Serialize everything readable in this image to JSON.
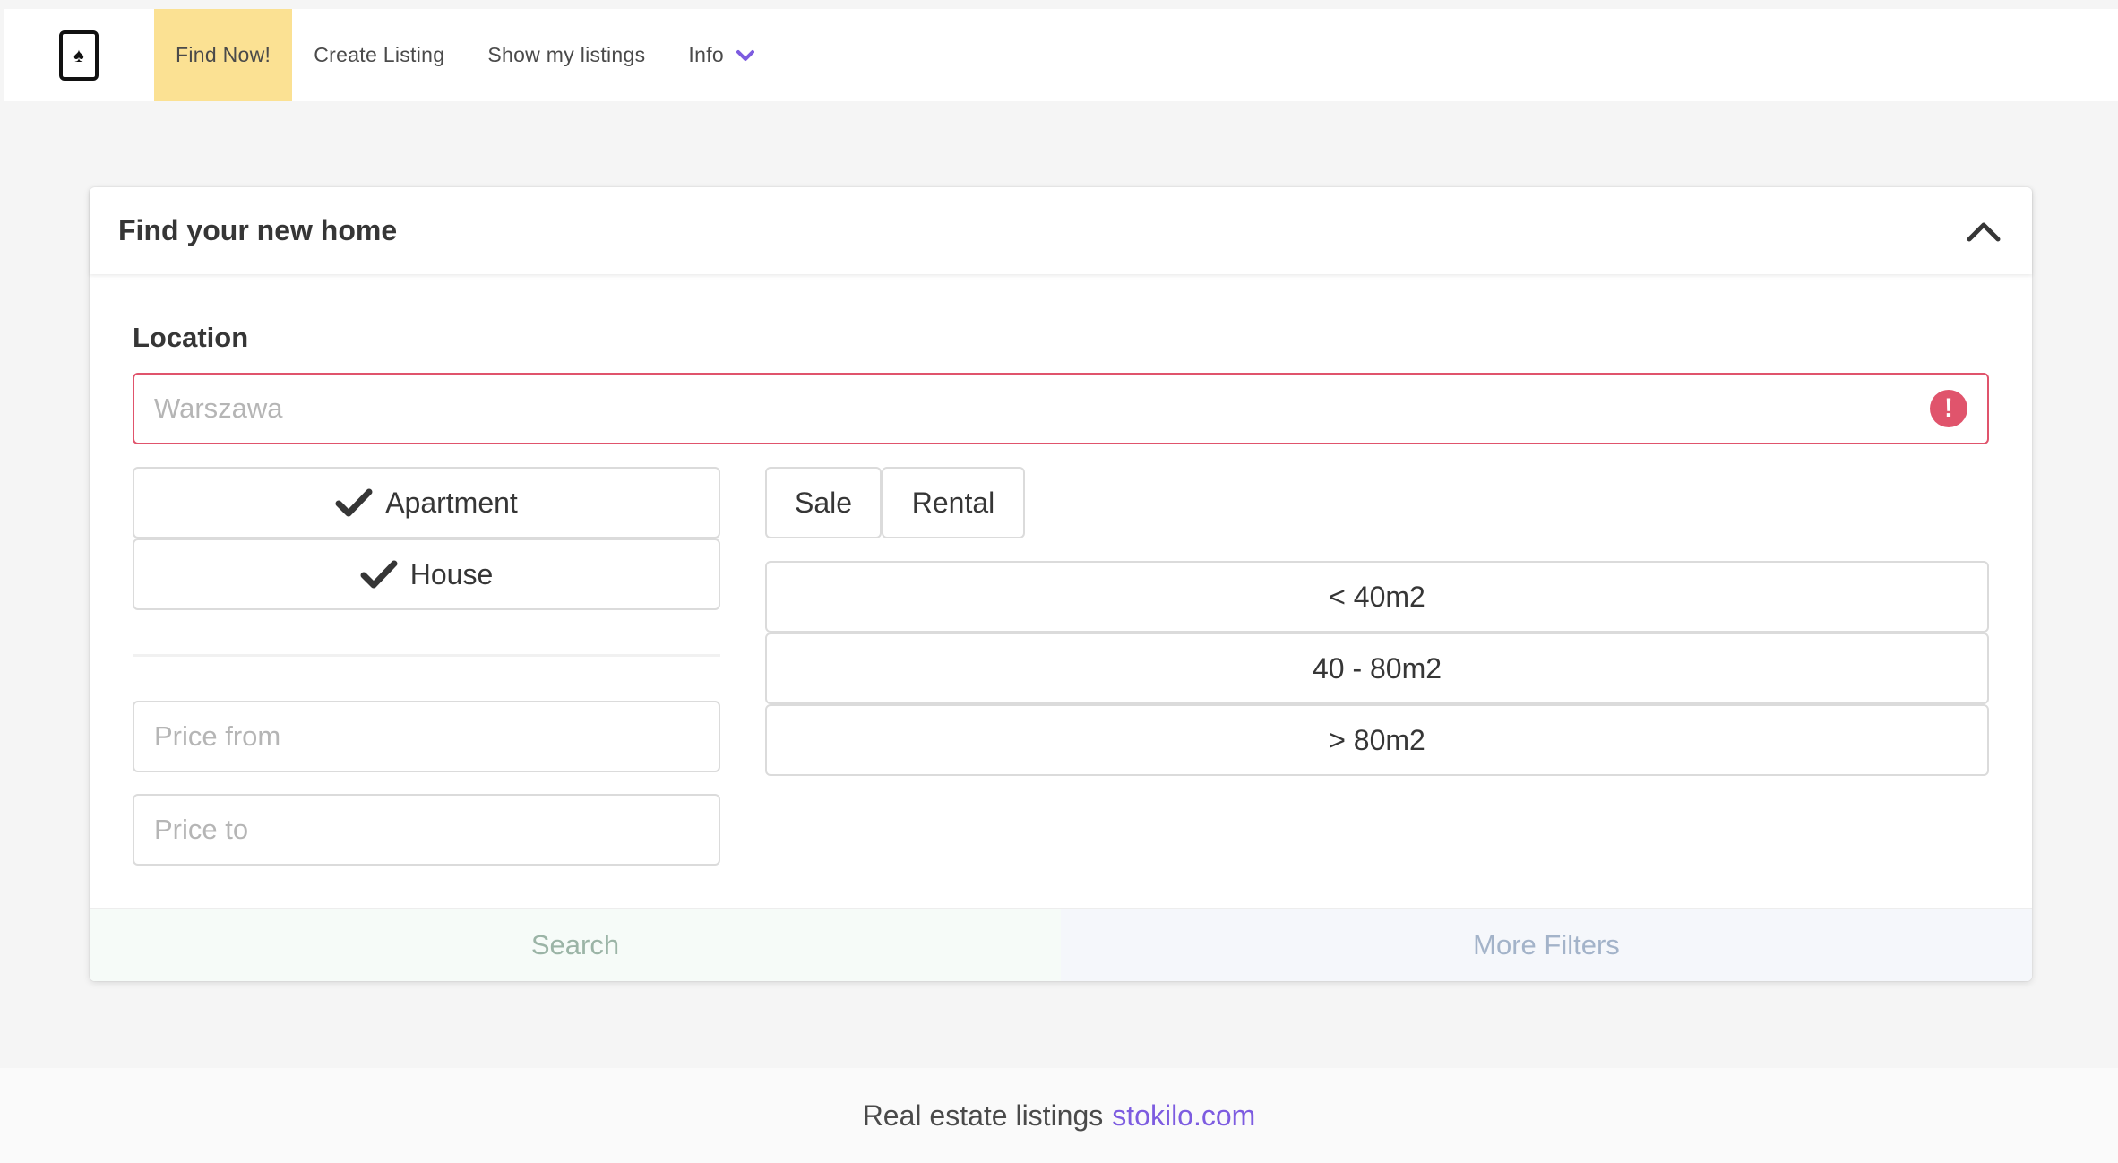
{
  "navbar": {
    "logo_icon": "spade-card-icon",
    "items": [
      {
        "label": "Find Now!",
        "active": true
      },
      {
        "label": "Create Listing",
        "active": false
      },
      {
        "label": "Show my listings",
        "active": false
      },
      {
        "label": "Info",
        "active": false,
        "dropdown": true
      }
    ],
    "active_color": "#fbe193",
    "dropdown_icon_color": "#7d5ce0"
  },
  "card": {
    "title": "Find your new home",
    "collapse_icon": "chevron-up-icon",
    "location": {
      "label": "Location",
      "placeholder": "Warszawa",
      "value": "",
      "error_icon": "exclamation-circle-icon",
      "error_color": "#e0546c"
    },
    "property_types": [
      {
        "label": "Apartment",
        "checked": true
      },
      {
        "label": "House",
        "checked": true
      }
    ],
    "offer_types": [
      {
        "label": "Sale"
      },
      {
        "label": "Rental"
      }
    ],
    "area_ranges": [
      {
        "label": "< 40m2"
      },
      {
        "label": "40 - 80m2"
      },
      {
        "label": "> 80m2"
      }
    ],
    "price_from": {
      "placeholder": "Price from",
      "value": ""
    },
    "price_to": {
      "placeholder": "Price to",
      "value": ""
    },
    "footer": {
      "search_label": "Search",
      "more_filters_label": "More Filters"
    }
  },
  "page_footer": {
    "text": "Real estate listings",
    "link": "stokilo.com",
    "link_color": "#7d5ce0"
  }
}
